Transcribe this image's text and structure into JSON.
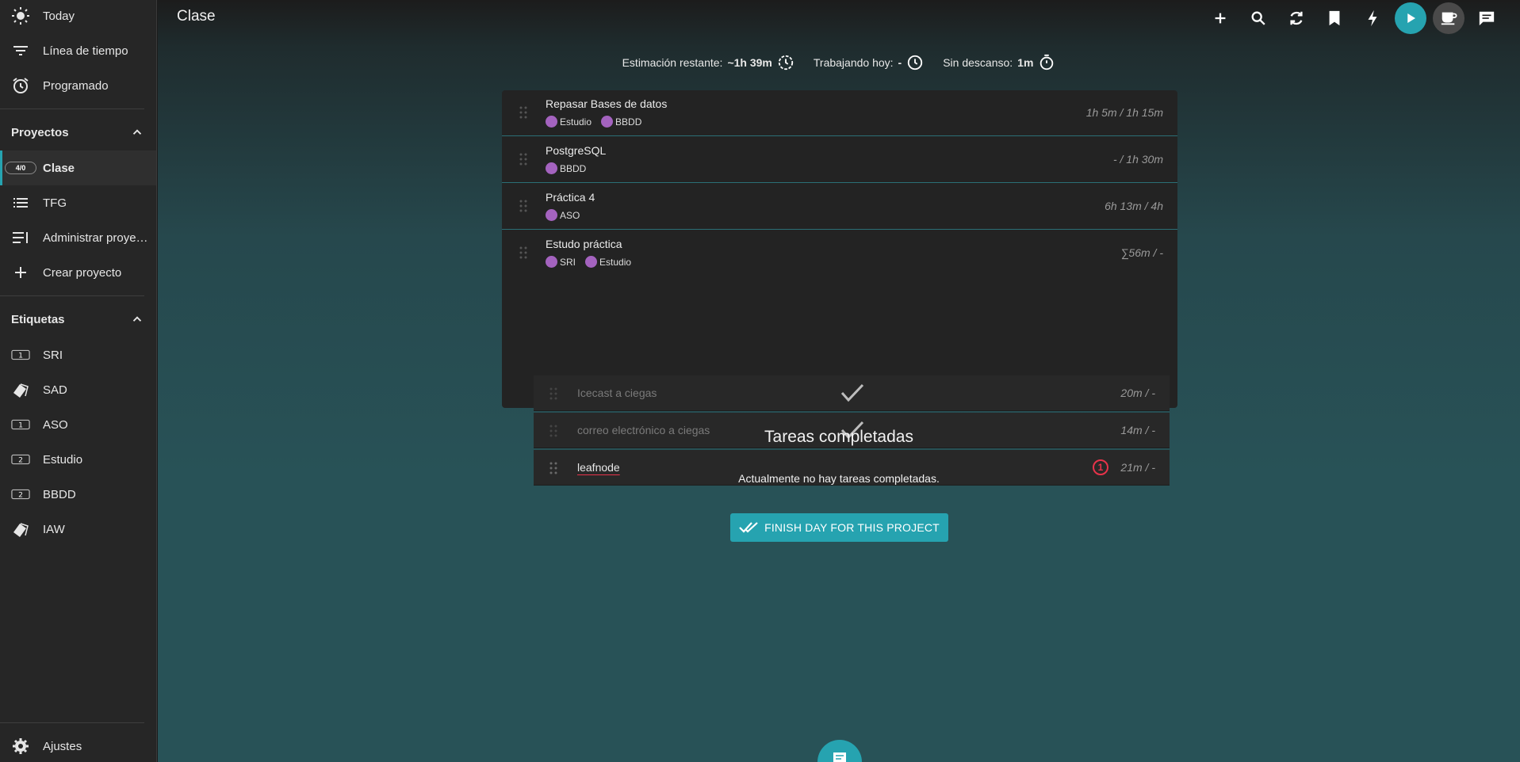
{
  "app": {
    "accent": "#26a3b0",
    "tag_color": "#a463bf",
    "alert_color": "#e8334a"
  },
  "sidebar": {
    "top_items": [
      {
        "label": "Today",
        "icon": "sun-icon"
      },
      {
        "label": "Línea de tiempo",
        "icon": "timeline-icon"
      },
      {
        "label": "Programado",
        "icon": "alarm-icon"
      }
    ],
    "projects_heading": "Proyectos",
    "projects": [
      {
        "label": "Clase",
        "badge": "4/0",
        "active": true
      },
      {
        "label": "TFG",
        "icon": "list-icon"
      },
      {
        "label": "Administrar proyectos",
        "icon": "manage-list-icon"
      },
      {
        "label": "Crear proyecto",
        "icon": "plus-icon"
      }
    ],
    "tags_heading": "Etiquetas",
    "tags": [
      {
        "label": "SRI",
        "icon_num": "1"
      },
      {
        "label": "SAD",
        "icon_num": ""
      },
      {
        "label": "ASO",
        "icon_num": "1"
      },
      {
        "label": "Estudio",
        "icon_num": "2"
      },
      {
        "label": "BBDD",
        "icon_num": "2"
      },
      {
        "label": "IAW",
        "icon_num": ""
      }
    ],
    "settings_label": "Ajustes"
  },
  "header": {
    "title": "Clase"
  },
  "stats": {
    "remaining_label": "Estimación restante:",
    "remaining_value": "~1h 39m",
    "today_label": "Trabajando hoy:",
    "today_value": "-",
    "nobreak_label": "Sin descanso:",
    "nobreak_value": "1m"
  },
  "tasks": [
    {
      "title": "Repasar Bases de datos",
      "tags": [
        "Estudio",
        "BBDD"
      ],
      "time": "1h 5m / 1h 15m"
    },
    {
      "title": "PostgreSQL",
      "tags": [
        "BBDD"
      ],
      "time": "- / 1h 30m"
    },
    {
      "title": "Práctica 4",
      "tags": [
        "ASO"
      ],
      "time": "6h 13m / 4h"
    },
    {
      "title": "Estudo práctica",
      "tags": [
        "SRI",
        "Estudio"
      ],
      "time": "∑56m / -"
    }
  ],
  "subtasks": [
    {
      "title": "Icecast a ciegas",
      "done": true,
      "time": "20m / -"
    },
    {
      "title": "correo electrónico a ciegas",
      "done": true,
      "time": "14m / -"
    },
    {
      "title": "leafnode",
      "done": false,
      "time": "21m / -",
      "alert": "1"
    }
  ],
  "completed": {
    "heading": "Tareas completadas",
    "empty_text": "Actualmente no hay tareas completadas.",
    "finish_button": "FINISH DAY FOR THIS PROJECT"
  }
}
